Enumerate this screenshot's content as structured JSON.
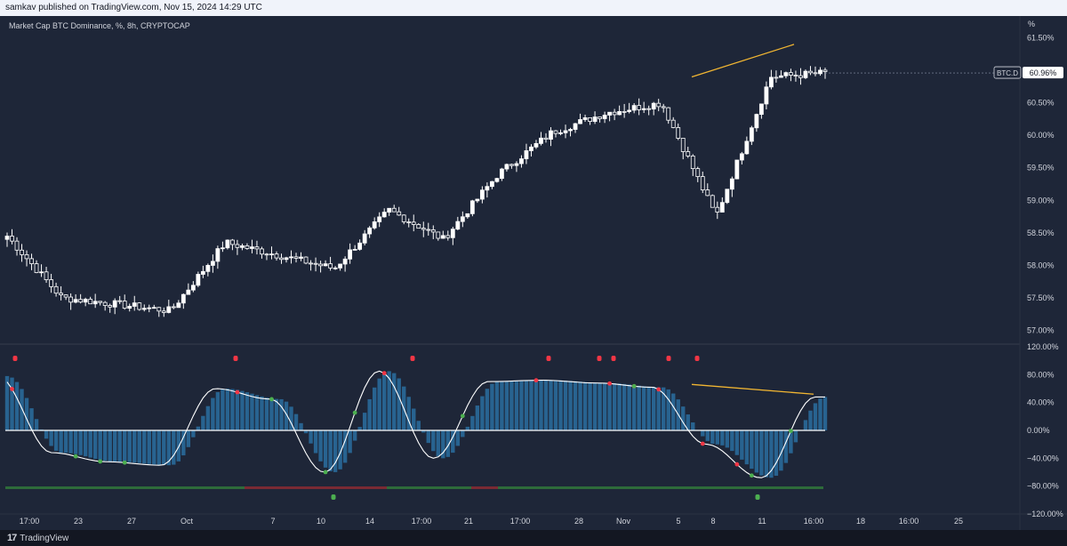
{
  "header": {
    "published": "samkav published on TradingView.com, Nov 15, 2024 14:29 UTC"
  },
  "legend": {
    "title": "Market Cap BTC Dominance, %, 8h, CRYPTOCAP"
  },
  "price_axis": {
    "unit": "%",
    "labels": [
      "61.50%",
      "61.00%",
      "60.50%",
      "60.00%",
      "59.50%",
      "59.00%",
      "58.50%",
      "58.00%",
      "57.50%",
      "57.00%"
    ],
    "ticker": "BTC.D",
    "last_value": "60.96%"
  },
  "osc_axis": {
    "labels": [
      "120.00%",
      "80.00%",
      "40.00%",
      "0.00%",
      "−40.00%",
      "−80.00%",
      "−120.00%"
    ]
  },
  "time_axis": {
    "labels": [
      "17:00",
      "23",
      "27",
      "Oct",
      "7",
      "10",
      "14",
      "17:00",
      "21",
      "17:00",
      "28",
      "Nov",
      "5",
      "8",
      "11",
      "16:00",
      "18",
      "16:00",
      "25"
    ]
  },
  "footer": {
    "brand": "TradingView",
    "logo_text": "17"
  },
  "colors": {
    "background": "#1e2638",
    "candle": "#ffffff",
    "trendline": "#f2b632",
    "histogram": "#2a6fa0",
    "osc_line": "#a8d8f0",
    "dot_red": "#f23645",
    "dot_green": "#4caf50"
  },
  "chart_data": [
    {
      "type": "candlestick",
      "title": "Market Cap BTC Dominance, %, 8h, CRYPTOCAP",
      "ylim": [
        56.8,
        61.7
      ],
      "x": [
        "17:00",
        "23",
        "27",
        "Oct",
        "7",
        "10",
        "14",
        "17:00",
        "21",
        "17:00",
        "28",
        "Nov",
        "5",
        "8",
        "11",
        "16:00"
      ],
      "close": [
        58.45,
        57.5,
        57.4,
        57.3,
        58.35,
        58.15,
        57.95,
        58.85,
        58.4,
        59.4,
        60.05,
        60.35,
        60.5,
        58.75,
        60.9,
        60.96
      ],
      "trendline": {
        "from": [
          60.9,
          61.4
        ]
      }
    },
    {
      "type": "bar",
      "title": "",
      "ylim": [
        -120,
        120
      ],
      "x": [
        "17:00",
        "23",
        "27",
        "Oct",
        "7",
        "10",
        "14",
        "17:00",
        "21",
        "17:00",
        "28",
        "Nov",
        "5",
        "8",
        "11",
        "16:00"
      ],
      "values": [
        78,
        -32,
        -45,
        -50,
        60,
        45,
        -60,
        85,
        -40,
        70,
        72,
        68,
        62,
        -20,
        -68,
        48
      ],
      "trendline": {
        "from": [
          66,
          52
        ]
      }
    }
  ]
}
